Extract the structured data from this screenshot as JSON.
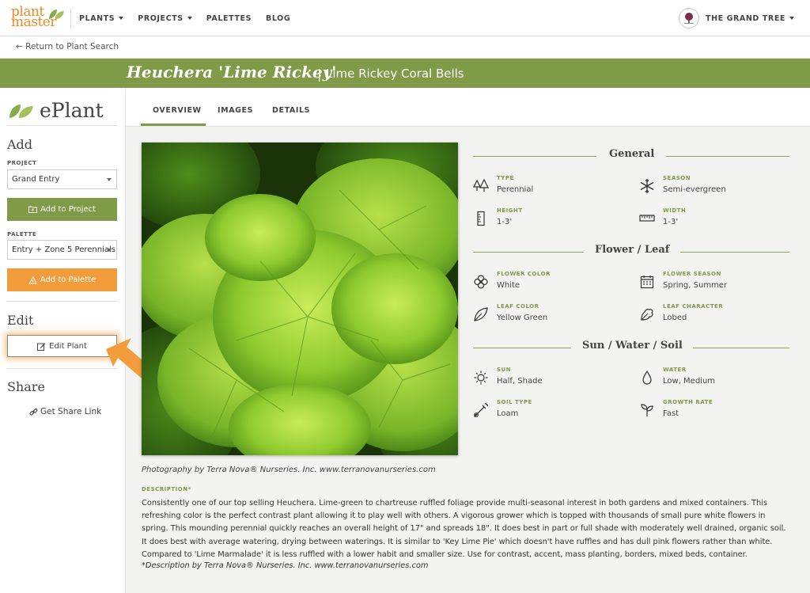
{
  "nav": {
    "logo_line1": "plant",
    "logo_line2": "master",
    "items": [
      "PLANTS",
      "PROJECTS",
      "PALETTES",
      "BLOG"
    ],
    "account_name": "THE GRAND TREE"
  },
  "return_link": "← Return to Plant Search",
  "plant": {
    "scientific_name": "Heuchera 'Lime Rickey'",
    "separator": "|",
    "common_name": "Lime Rickey Coral Bells"
  },
  "sidebar": {
    "title": "ePlant",
    "add_heading": "Add",
    "project_label": "PROJECT",
    "project_value": "Grand Entry",
    "add_to_project": "Add to Project",
    "palette_label": "PALETTE",
    "palette_value": "Entry + Zone 5 Perennials",
    "add_to_palette": "Add to Palette",
    "edit_heading": "Edit",
    "edit_plant": "Edit Plant",
    "share_heading": "Share",
    "share_link": "Get Share Link"
  },
  "tabs": [
    "OVERVIEW",
    "IMAGES",
    "DETAILS"
  ],
  "groups": {
    "general": "General",
    "flower_leaf": "Flower / Leaf",
    "sun_water_soil": "Sun / Water / Soil"
  },
  "attributes": {
    "type": {
      "label": "TYPE",
      "value": "Perennial"
    },
    "season": {
      "label": "SEASON",
      "value": "Semi-evergreen"
    },
    "height": {
      "label": "HEIGHT",
      "value": "1-3'"
    },
    "width": {
      "label": "WIDTH",
      "value": "1-3'"
    },
    "flower_color": {
      "label": "FLOWER COLOR",
      "value": "White"
    },
    "flower_season": {
      "label": "FLOWER SEASON",
      "value": "Spring, Summer"
    },
    "leaf_color": {
      "label": "LEAF COLOR",
      "value": "Yellow Green"
    },
    "leaf_character": {
      "label": "LEAF CHARACTER",
      "value": "Lobed"
    },
    "sun": {
      "label": "SUN",
      "value": "Half, Shade"
    },
    "water": {
      "label": "WATER",
      "value": "Low, Medium"
    },
    "soil_type": {
      "label": "SOIL TYPE",
      "value": "Loam"
    },
    "growth_rate": {
      "label": "GROWTH RATE",
      "value": "Fast"
    }
  },
  "photo_caption": "Photography by Terra Nova® Nurseries. Inc. www.terranovanurseries.com",
  "description_label": "DESCRIPTION*",
  "description": "Consistently one of our top selling Heuchera. Lime-green to chartreuse ruffled foliage provide multi-seasonal interest in both gardens and mixed containers. This refreshing color is the perfect contrast plant allowing it to play well with others. A vigorous grower which is topped with thousands of small pure white flowers in spring. This mounding perennial quickly reaches an overall height of 17\" and spreads 18\". It does best in part or full shade with moderately well drained, organic soil. It does best with average watering, drying between waterings. It is similar to 'Key Lime Pie' which doesn't have ruffles and has dull pink flowers rather than white. Compared to 'Lime Marmalade' it is less ruffled with a lower habit and smaller size. Use for contrast, accent, mass planting, borders, mixed beds, container.",
  "description_credit": "*Description by Terra Nova® Nurseries. Inc. www.terranovanurseries.com",
  "colors": {
    "brand_green": "#7f9b47",
    "brand_orange": "#f39c3c",
    "logo_orange": "#f08a24"
  }
}
